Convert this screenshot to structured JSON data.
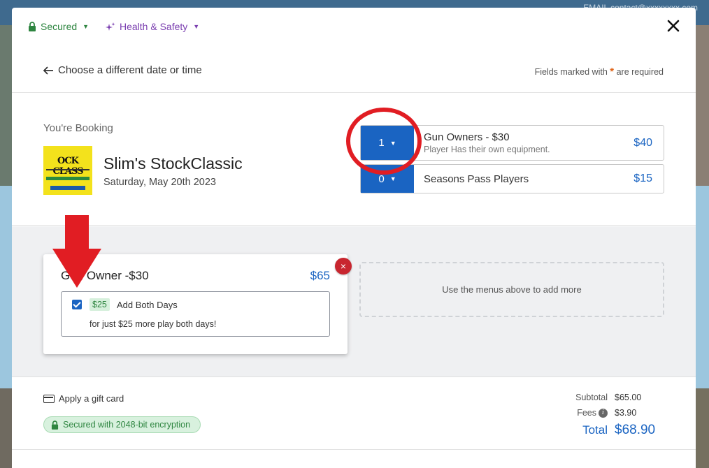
{
  "background": {
    "top_text": "EMAIL contact@xxxxxxxx.com"
  },
  "topbar": {
    "secured_label": "Secured",
    "health_label": "Health & Safety"
  },
  "backrow": {
    "back_label": "Choose a different date or time",
    "required_prefix": "Fields marked with",
    "required_star": "*",
    "required_suffix": "are required"
  },
  "booking": {
    "heading": "You're Booking",
    "event_title": "Slim's StockClassic",
    "event_date": "Saturday, May 20th 2023",
    "thumb_text": "OCK CLASS"
  },
  "tickets": [
    {
      "qty": "1",
      "name": "Gun Owners - $30",
      "description": "Player Has their own equipment.",
      "price": "$40"
    },
    {
      "qty": "0",
      "name": "Seasons Pass Players",
      "description": "",
      "price": "$15"
    }
  ],
  "cart": {
    "item_title": "Gun Owner -$30",
    "item_price": "$65",
    "remove_label": "×",
    "addon": {
      "checked": true,
      "badge": "$25",
      "name": "Add Both Days",
      "description": "for just $25 more play both days!"
    },
    "add_more_text": "Use the menus above to add more"
  },
  "footer": {
    "gift_card_label": "Apply a gift card",
    "secure_label": "Secured with 2048-bit encryption",
    "subtotal_label": "Subtotal",
    "subtotal_value": "$65.00",
    "fees_label": "Fees",
    "fees_value": "$3.90",
    "total_label": "Total",
    "total_value": "$68.90"
  },
  "colors": {
    "brand_blue": "#1a64c2",
    "secure_green": "#2e8540",
    "health_purple": "#7b3fb0",
    "annotation_red": "#e11d23"
  }
}
